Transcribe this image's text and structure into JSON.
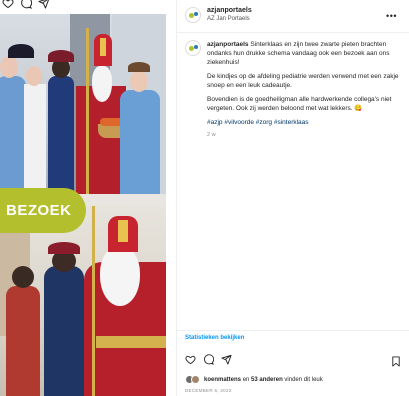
{
  "photo": {
    "banner_text": "BEZOEK"
  },
  "header": {
    "username": "azjanportaels",
    "subtitle": "AZ Jan Portaels",
    "more_icon": "more-horizontal-icon"
  },
  "caption": {
    "username": "azjanportaels",
    "text": "Sinterklaas en zijn twee zwarte pieten brachten ondanks hun drukke schema vandaag ook een bezoek aan ons ziekenhuis!",
    "para2": "De kindjes op de afdeling pediatrie werden verwend met een zakje snoep en een leuk cadeautje.",
    "para3": "Bovendien is de goedheiligman alle hardwerkende collega's niet vergeten. Ook zij werden beloond met wat lekkers. 😋",
    "hashtags": "#azjp #vilvoorde #zorg #sinterklaas",
    "time": "2 w"
  },
  "insights_link": "Statistieken bekijken",
  "likes": {
    "first_user": "koenmattens",
    "connector": "en",
    "others": "53 anderen",
    "suffix": "vinden dit leuk"
  },
  "date": "DECEMBER 6, 2022",
  "colors": {
    "brand_green": "#b3bf2d",
    "link_blue": "#0095f6",
    "hashtag_blue": "#00376b"
  }
}
